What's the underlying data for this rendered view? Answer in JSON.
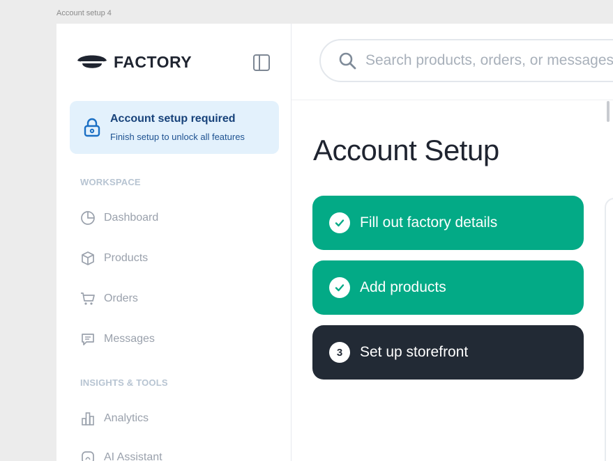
{
  "frame_label": "Account setup 4",
  "brand": {
    "name": "FACTORY"
  },
  "setup_notice": {
    "title": "Account setup required",
    "subtitle": "Finish setup to unlock all features"
  },
  "sidebar": {
    "sections": [
      {
        "label": "WORKSPACE",
        "items": [
          {
            "label": "Dashboard",
            "icon": "pie-chart-icon"
          },
          {
            "label": "Products",
            "icon": "box-icon"
          },
          {
            "label": "Orders",
            "icon": "cart-icon"
          },
          {
            "label": "Messages",
            "icon": "message-icon"
          }
        ]
      },
      {
        "label": "INSIGHTS & TOOLS",
        "items": [
          {
            "label": "Analytics",
            "icon": "bar-chart-icon"
          },
          {
            "label": "AI Assistant",
            "icon": "ai-icon"
          }
        ]
      }
    ]
  },
  "search": {
    "placeholder": "Search products, orders, or messages"
  },
  "page": {
    "title": "Account Setup",
    "steps": [
      {
        "label": "Fill out factory details",
        "status": "complete"
      },
      {
        "label": "Add products",
        "status": "complete"
      },
      {
        "label": "Set up storefront",
        "status": "current",
        "number": "3"
      }
    ]
  },
  "colors": {
    "complete": "#03aa86",
    "current": "#222a35",
    "notice_bg": "#e3f1fc",
    "notice_text": "#17427a"
  }
}
